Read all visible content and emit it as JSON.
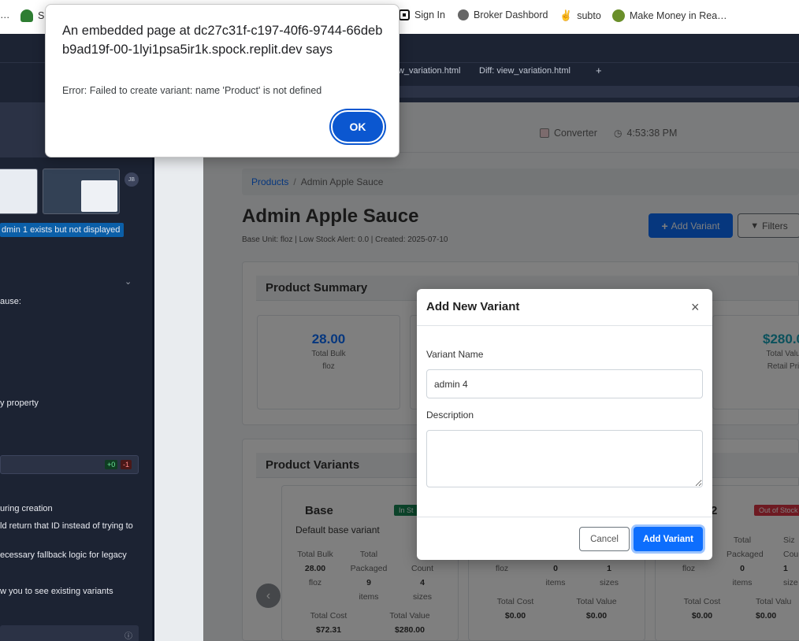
{
  "bookmarks": [
    {
      "label": "S…",
      "icon": "green-hat-icon"
    },
    {
      "label": "Sign In",
      "icon": "square-logo-icon"
    },
    {
      "label": "Broker Dashbord",
      "icon": "globe-icon"
    },
    {
      "label": "subto",
      "icon": "peace-hand-icon"
    },
    {
      "label": "Make Money in Rea…",
      "icon": "frog-icon"
    }
  ],
  "leading_ellipsis": "…",
  "editor_tabs": [
    "w_variation.html",
    "Diff: view_variation.html"
  ],
  "new_tab_symbol": "+",
  "sidebar": {
    "avatar_initials": "JB",
    "highlight_text": "dmin 1 exists but not displayed",
    "lines": [
      "ause:",
      "y property",
      "uring creation",
      "ld return that ID instead of trying to",
      "ecessary fallback logic for legacy",
      "w you to see existing variants"
    ],
    "diff_added": "+0",
    "diff_removed": "-1"
  },
  "app_header": {
    "converter_label": "Converter",
    "clock_time": "4:53:38 PM"
  },
  "breadcrumb": {
    "root": "Products",
    "separator": "/",
    "current": "Admin Apple Sauce"
  },
  "product": {
    "title": "Admin Apple Sauce",
    "meta": "Base Unit: floz | Low Stock Alert: 0.0 | Created: 2025-07-10",
    "add_variant_label": "Add Variant",
    "filters_label": "Filters"
  },
  "summary": {
    "heading": "Product Summary",
    "stats": [
      {
        "value": "28.00",
        "label": "Total Bulk",
        "unit": "floz",
        "color": "#0d6efd"
      },
      {
        "value": "$280.0",
        "label": "Total Valu",
        "unit": "Retail Pri",
        "color": "#17a2b8"
      }
    ]
  },
  "variants": {
    "heading": "Product Variants",
    "prev_symbol": "‹",
    "base": {
      "name": "Base",
      "badge": "In St",
      "description": "Default base variant",
      "total_bulk_label": "Total Bulk",
      "total_bulk": "28.00",
      "total_bulk_unit": "floz",
      "packaged_label_1": "Total",
      "packaged_label_2": "Packaged",
      "packaged_value": "9",
      "packaged_unit": "items",
      "count_label": "Count",
      "count_value": "4",
      "count_unit": "sizes",
      "cost_label": "Total Cost",
      "cost_value": "$72.31",
      "value_label": "Total Value",
      "value_value": "$280.00"
    },
    "middle": {
      "unit": "floz",
      "packaged_value": "0",
      "packaged_unit": "items",
      "count_value": "1",
      "count_unit": "sizes",
      "cost_label": "Total Cost",
      "cost_value": "$0.00",
      "value_label": "Total Value",
      "value_value": "$0.00"
    },
    "right": {
      "name_tail": "2",
      "badge": "Out of Stock",
      "packaged_label_1": "Total",
      "packaged_label_2": "Packaged",
      "size_label_1": "Siz",
      "size_label_2": "Cou",
      "unit": "floz",
      "packaged_value": "0",
      "packaged_unit": "items",
      "count_value": "1",
      "count_unit": "size",
      "cost_label": "Total Cost",
      "cost_value": "$0.00",
      "value_label": "Total Valu",
      "value_value": "$0.00"
    }
  },
  "modal": {
    "title": "Add New Variant",
    "close_symbol": "×",
    "name_label": "Variant Name",
    "name_value": "admin 4",
    "description_label": "Description",
    "description_value": "",
    "cancel_label": "Cancel",
    "submit_label": "Add Variant"
  },
  "alert": {
    "title": "An embedded page at dc27c31f-c197-40f6-9744-66debb9ad19f-00-1lyi1psa5ir1k.spock.replit.dev says",
    "message": "Error: Failed to create variant: name 'Product' is not defined",
    "ok_label": "OK"
  },
  "colors": {
    "primary": "#0d6efd",
    "success": "#198754",
    "danger": "#dc3545",
    "info": "#17a2b8",
    "ide_bg": "#1c2333",
    "chrome_blue": "#0b57d0"
  }
}
